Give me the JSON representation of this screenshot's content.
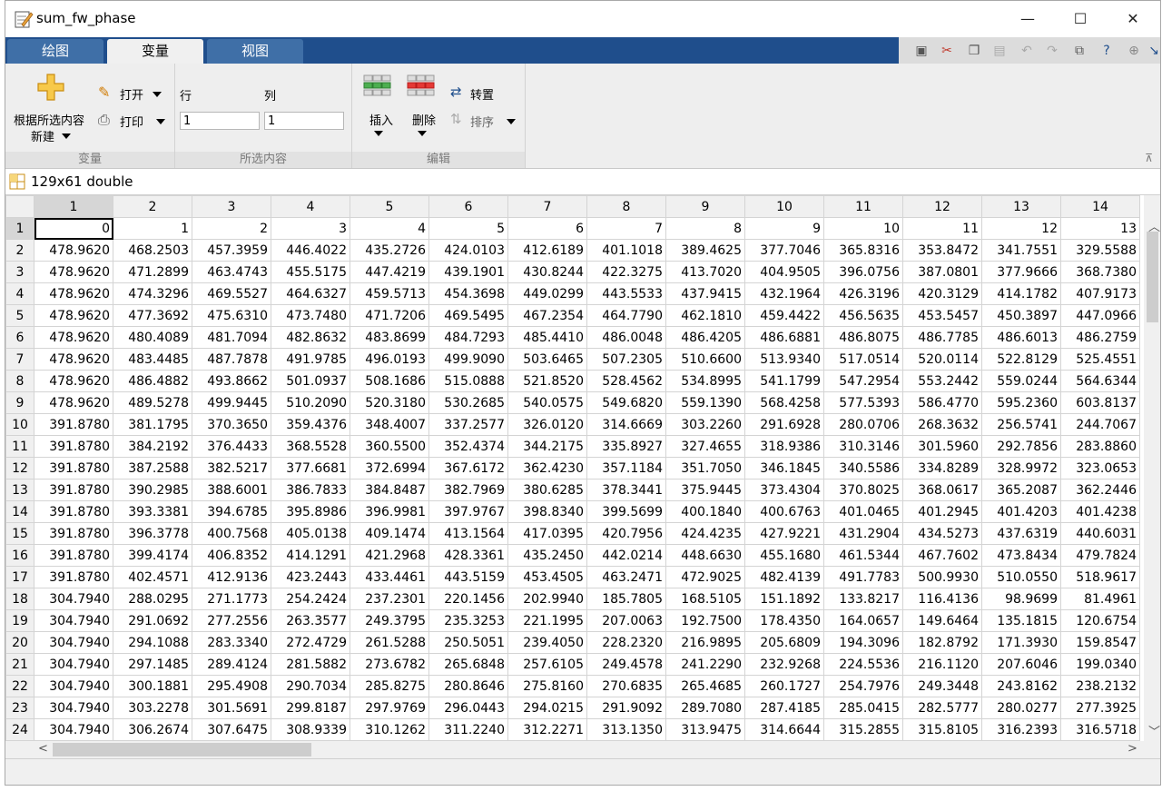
{
  "window": {
    "title": "sum_fw_phase",
    "min_icon": "minimize-icon",
    "max_icon": "maximize-icon",
    "close_icon": "close-icon",
    "min_glyph": "—",
    "max_glyph": "☐",
    "close_glyph": "✕"
  },
  "tabs": [
    {
      "label": "绘图",
      "active": false
    },
    {
      "label": "变量",
      "active": true
    },
    {
      "label": "视图",
      "active": false
    }
  ],
  "ribbon": {
    "new_from_selection_line1": "根据所选内容",
    "new_from_selection_line2": "新建",
    "open_label": "打开",
    "print_label": "打印",
    "row_label": "行",
    "col_label": "列",
    "row_value": "1",
    "col_value": "1",
    "insert_label": "插入",
    "delete_label": "删除",
    "transpose_label": "转置",
    "sort_label": "排序",
    "sections": {
      "variable": "变量",
      "selection": "所选内容",
      "edit": "编辑"
    }
  },
  "variable": {
    "label": "129x61 double"
  },
  "colors": {
    "tab_strip": "#1f4e8c",
    "ribbon_bg": "#eeeeee",
    "grid_border": "#d4d4d4"
  },
  "table": {
    "col_headers": [
      "1",
      "2",
      "3",
      "4",
      "5",
      "6",
      "7",
      "8",
      "9",
      "10",
      "11",
      "12",
      "13",
      "14"
    ],
    "rows": [
      {
        "n": "1",
        "cells": [
          "0",
          "1",
          "2",
          "3",
          "4",
          "5",
          "6",
          "7",
          "8",
          "9",
          "10",
          "11",
          "12",
          "13"
        ]
      },
      {
        "n": "2",
        "cells": [
          "478.9620",
          "468.2503",
          "457.3959",
          "446.4022",
          "435.2726",
          "424.0103",
          "412.6189",
          "401.1018",
          "389.4625",
          "377.7046",
          "365.8316",
          "353.8472",
          "341.7551",
          "329.5588"
        ]
      },
      {
        "n": "3",
        "cells": [
          "478.9620",
          "471.2899",
          "463.4743",
          "455.5175",
          "447.4219",
          "439.1901",
          "430.8244",
          "422.3275",
          "413.7020",
          "404.9505",
          "396.0756",
          "387.0801",
          "377.9666",
          "368.7380"
        ]
      },
      {
        "n": "4",
        "cells": [
          "478.9620",
          "474.3296",
          "469.5527",
          "464.6327",
          "459.5713",
          "454.3698",
          "449.0299",
          "443.5533",
          "437.9415",
          "432.1964",
          "426.3196",
          "420.3129",
          "414.1782",
          "407.9173"
        ]
      },
      {
        "n": "5",
        "cells": [
          "478.9620",
          "477.3692",
          "475.6310",
          "473.7480",
          "471.7206",
          "469.5495",
          "467.2354",
          "464.7790",
          "462.1810",
          "459.4422",
          "456.5635",
          "453.5457",
          "450.3897",
          "447.0966"
        ]
      },
      {
        "n": "6",
        "cells": [
          "478.9620",
          "480.4089",
          "481.7094",
          "482.8632",
          "483.8699",
          "484.7293",
          "485.4410",
          "486.0048",
          "486.4205",
          "486.6881",
          "486.8075",
          "486.7785",
          "486.6013",
          "486.2759"
        ]
      },
      {
        "n": "7",
        "cells": [
          "478.9620",
          "483.4485",
          "487.7878",
          "491.9785",
          "496.0193",
          "499.9090",
          "503.6465",
          "507.2305",
          "510.6600",
          "513.9340",
          "517.0514",
          "520.0114",
          "522.8129",
          "525.4551"
        ]
      },
      {
        "n": "8",
        "cells": [
          "478.9620",
          "486.4882",
          "493.8662",
          "501.0937",
          "508.1686",
          "515.0888",
          "521.8520",
          "528.4562",
          "534.8995",
          "541.1799",
          "547.2954",
          "553.2442",
          "559.0244",
          "564.6344"
        ]
      },
      {
        "n": "9",
        "cells": [
          "478.9620",
          "489.5278",
          "499.9445",
          "510.2090",
          "520.3180",
          "530.2685",
          "540.0575",
          "549.6820",
          "559.1390",
          "568.4258",
          "577.5393",
          "586.4770",
          "595.2360",
          "603.8137"
        ]
      },
      {
        "n": "10",
        "cells": [
          "391.8780",
          "381.1795",
          "370.3650",
          "359.4376",
          "348.4007",
          "337.2577",
          "326.0120",
          "314.6669",
          "303.2260",
          "291.6928",
          "280.0706",
          "268.3632",
          "256.5741",
          "244.7067"
        ]
      },
      {
        "n": "11",
        "cells": [
          "391.8780",
          "384.2192",
          "376.4433",
          "368.5528",
          "360.5500",
          "352.4374",
          "344.2175",
          "335.8927",
          "327.4655",
          "318.9386",
          "310.3146",
          "301.5960",
          "292.7856",
          "283.8860"
        ]
      },
      {
        "n": "12",
        "cells": [
          "391.8780",
          "387.2588",
          "382.5217",
          "377.6681",
          "372.6994",
          "367.6172",
          "362.4230",
          "357.1184",
          "351.7050",
          "346.1845",
          "340.5586",
          "334.8289",
          "328.9972",
          "323.0653"
        ]
      },
      {
        "n": "13",
        "cells": [
          "391.8780",
          "390.2985",
          "388.6001",
          "386.7833",
          "384.8487",
          "382.7969",
          "380.6285",
          "378.3441",
          "375.9445",
          "373.4304",
          "370.8025",
          "368.0617",
          "365.2087",
          "362.2446"
        ]
      },
      {
        "n": "14",
        "cells": [
          "391.8780",
          "393.3381",
          "394.6785",
          "395.8986",
          "396.9981",
          "397.9767",
          "398.8340",
          "399.5699",
          "400.1840",
          "400.6763",
          "401.0465",
          "401.2945",
          "401.4203",
          "401.4238"
        ]
      },
      {
        "n": "15",
        "cells": [
          "391.8780",
          "396.3778",
          "400.7568",
          "405.0138",
          "409.1474",
          "413.1564",
          "417.0395",
          "420.7956",
          "424.4235",
          "427.9221",
          "431.2904",
          "434.5273",
          "437.6319",
          "440.6031"
        ]
      },
      {
        "n": "16",
        "cells": [
          "391.8780",
          "399.4174",
          "406.8352",
          "414.1291",
          "421.2968",
          "428.3361",
          "435.2450",
          "442.0214",
          "448.6630",
          "455.1680",
          "461.5344",
          "467.7602",
          "473.8434",
          "479.7824"
        ]
      },
      {
        "n": "17",
        "cells": [
          "391.8780",
          "402.4571",
          "412.9136",
          "423.2443",
          "433.4461",
          "443.5159",
          "453.4505",
          "463.2471",
          "472.9025",
          "482.4139",
          "491.7783",
          "500.9930",
          "510.0550",
          "518.9617"
        ]
      },
      {
        "n": "18",
        "cells": [
          "304.7940",
          "288.0295",
          "271.1773",
          "254.2424",
          "237.2301",
          "220.1456",
          "202.9940",
          "185.7805",
          "168.5105",
          "151.1892",
          "133.8217",
          "116.4136",
          "98.9699",
          "81.4961"
        ]
      },
      {
        "n": "19",
        "cells": [
          "304.7940",
          "291.0692",
          "277.2556",
          "263.3577",
          "249.3795",
          "235.3253",
          "221.1995",
          "207.0063",
          "192.7500",
          "178.4350",
          "164.0657",
          "149.6464",
          "135.1815",
          "120.6754"
        ]
      },
      {
        "n": "20",
        "cells": [
          "304.7940",
          "294.1088",
          "283.3340",
          "272.4729",
          "261.5288",
          "250.5051",
          "239.4050",
          "228.2320",
          "216.9895",
          "205.6809",
          "194.3096",
          "182.8792",
          "171.3930",
          "159.8547"
        ]
      },
      {
        "n": "21",
        "cells": [
          "304.7940",
          "297.1485",
          "289.4124",
          "281.5882",
          "273.6782",
          "265.6848",
          "257.6105",
          "249.4578",
          "241.2290",
          "232.9268",
          "224.5536",
          "216.1120",
          "207.6046",
          "199.0340"
        ]
      },
      {
        "n": "22",
        "cells": [
          "304.7940",
          "300.1881",
          "295.4908",
          "290.7034",
          "285.8275",
          "280.8646",
          "275.8160",
          "270.6835",
          "265.4685",
          "260.1727",
          "254.7976",
          "249.3448",
          "243.8162",
          "238.2132"
        ]
      },
      {
        "n": "23",
        "cells": [
          "304.7940",
          "303.2278",
          "301.5691",
          "299.8187",
          "297.9769",
          "296.0443",
          "294.0215",
          "291.9092",
          "289.7080",
          "287.4185",
          "285.0415",
          "282.5777",
          "280.0277",
          "277.3925"
        ]
      },
      {
        "n": "24",
        "cells": [
          "304.7940",
          "306.2674",
          "307.6475",
          "308.9339",
          "310.1262",
          "311.2240",
          "312.2271",
          "313.1350",
          "313.9475",
          "314.6644",
          "315.2855",
          "315.8105",
          "316.2393",
          "316.5718"
        ]
      }
    ]
  }
}
